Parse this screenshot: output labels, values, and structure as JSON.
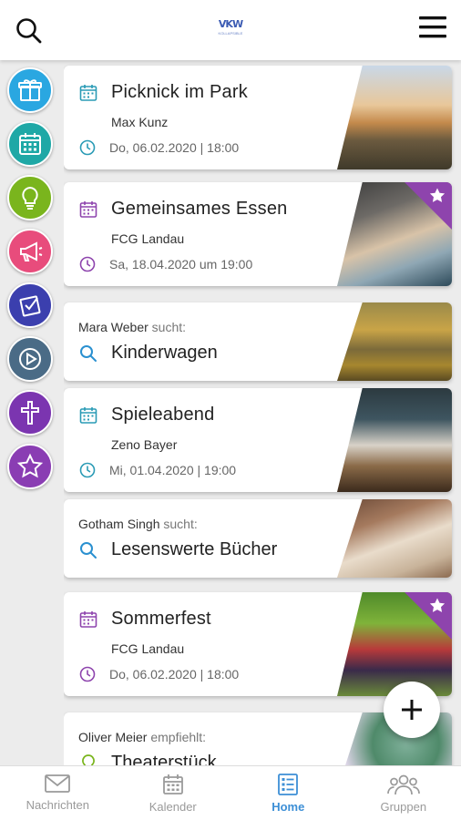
{
  "header": {
    "logo_text": "KOLLAPSIBLE"
  },
  "sidebar": {
    "categories": [
      {
        "name": "gift",
        "color": "#2aa7e1"
      },
      {
        "name": "calendar",
        "color": "#1fa8a6"
      },
      {
        "name": "idea",
        "color": "#7ab51d"
      },
      {
        "name": "announcement",
        "color": "#e84c7c"
      },
      {
        "name": "tasks",
        "color": "#3b3fae"
      },
      {
        "name": "media",
        "color": "#4a6b86"
      },
      {
        "name": "faith",
        "color": "#7b35b0"
      },
      {
        "name": "favorites",
        "color": "#8a3db3"
      }
    ]
  },
  "feed": {
    "cards": [
      {
        "type": "event",
        "title": "Picknick im Park",
        "organizer": "Max Kunz",
        "date": "Do, 06.02.2020 | 18:00",
        "accent": "#2a9bb5"
      },
      {
        "type": "event",
        "title": "Gemeinsames Essen",
        "organizer": "FCG Landau",
        "date": "Sa, 18.04.2020 um 19:00",
        "accent": "#8e44ad",
        "featured": true
      },
      {
        "type": "seek",
        "person": "Mara Weber",
        "verb": "sucht:",
        "title": "Kinderwagen"
      },
      {
        "type": "event",
        "title": "Spieleabend",
        "organizer": "Zeno Bayer",
        "date": "Mi, 01.04.2020 | 19:00",
        "accent": "#2a9bb5"
      },
      {
        "type": "seek",
        "person": "Gotham Singh",
        "verb": "sucht:",
        "title": "Lesenswerte Bücher"
      },
      {
        "type": "event",
        "title": "Sommerfest",
        "organizer": "FCG Landau",
        "date": "Do, 06.02.2020 | 18:00",
        "accent": "#8e44ad",
        "featured": true
      },
      {
        "type": "recommend",
        "person": "Oliver Meier",
        "verb": "empfiehlt:",
        "title": "Theaterstück"
      }
    ]
  },
  "bottom_nav": [
    {
      "label": "Nachrichten",
      "icon": "mail-icon",
      "active": false
    },
    {
      "label": "Kalender",
      "icon": "calendar-icon",
      "active": false
    },
    {
      "label": "Home",
      "icon": "home-list-icon",
      "active": true
    },
    {
      "label": "Gruppen",
      "icon": "groups-icon",
      "active": false
    }
  ]
}
